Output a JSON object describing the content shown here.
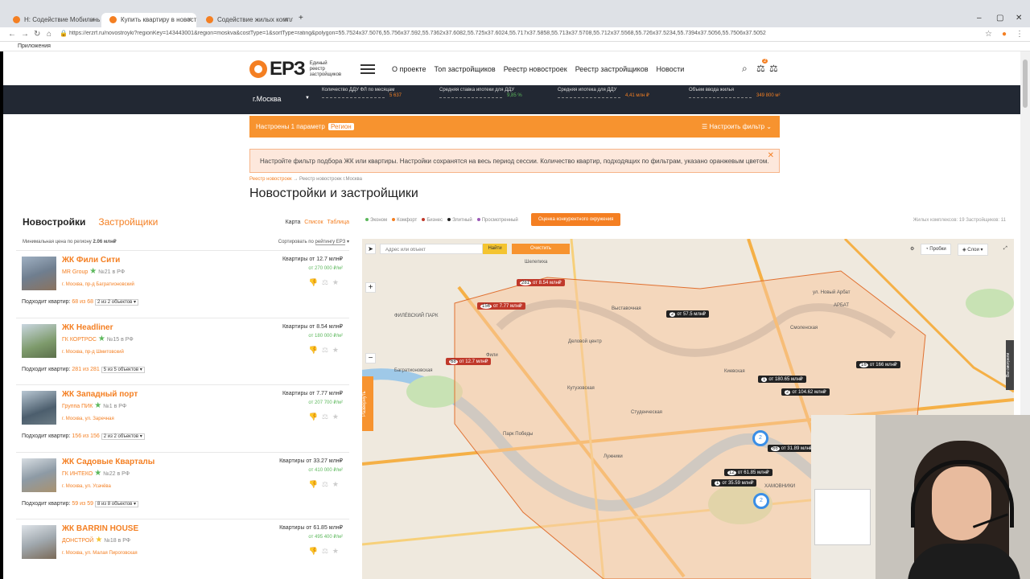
{
  "browser": {
    "tabs": [
      {
        "label": "Н: Содействие Мобильные ПРОБ..."
      },
      {
        "label": "Купить квартиру в новостройке..."
      },
      {
        "label": "Содействие жилых комплексов..."
      }
    ],
    "url": "https://erzrf.ru/novostroyki?regionKey=143443001&region=moskva&costType=1&sortType=rating&polygon=55.7524x37.5076,55.756x37.592,55.7362x37.6082,55.725x37.6024,55.717x37.5858,55.713x37.5708,55.712x37.5568,55.726x37.5234,55.7394x37.5056,55.7506x37.5052",
    "bookmarks_label": "Приложения"
  },
  "header": {
    "logo_text": "ЕРЗ",
    "logo_sub": "Единый реестр застройщиков",
    "nav": [
      "О проекте",
      "Топ застройщиков",
      "Реестр новостроек",
      "Реестр застройщиков",
      "Новости"
    ],
    "notif_count": "2"
  },
  "stats": {
    "city": "г.Москва",
    "items": [
      {
        "label": "Количество ДДУ ФЛ по месяцам",
        "value": "5 637"
      },
      {
        "label": "Средняя ставка ипотеки для ДДУ",
        "value": "9,85 %"
      },
      {
        "label": "Средняя ипотека для ДДУ",
        "value": "4,41 млн ₽"
      },
      {
        "label": "Объем ввода жилья",
        "value": "349 800 м²"
      }
    ]
  },
  "filter": {
    "prefix": "Настроены 1 параметр",
    "chip": "Регион",
    "settings": "Настроить фильтр"
  },
  "notice": "Настройте фильтр подбора ЖК или квартиры. Настройки сохранятся на весь период сессии. Количество квартир, подходящих по фильтрам, указано оранжевым цветом.",
  "breadcrumbs": {
    "a": "Реестр новостроек",
    "sep": "→",
    "b": "Реестр новостроек г.Москва"
  },
  "page_title": "Новостройки и застройщики",
  "left": {
    "tab_active": "Новостройки",
    "tab_other": "Застройщики",
    "view_map": "Карта",
    "view_list": "Список",
    "view_table": "Таблица",
    "min_price_label": "Минимальная цена по региону",
    "min_price": "2.06 млн₽",
    "sort_label": "Сортировать по",
    "sort_value": "рейтингу ЕРЗ",
    "fit_label": "Подходит квартир:",
    "items": [
      {
        "name": "ЖК Фили Сити",
        "developer": "MR Group",
        "rank": "№21 в РФ",
        "address": "г. Москва, пр-д Багратионовский",
        "price": "Квартиры от 12.7 млн₽",
        "ppm": "от 270 000 ₽/м²",
        "fit": "68 из 68",
        "objects": "2 из 2 объектов"
      },
      {
        "name": "ЖК Headliner",
        "developer": "ГК КОРТРОС",
        "rank": "№15 в РФ",
        "address": "г. Москва, пр-д Шмитовский",
        "price": "Квартиры от 8.54 млн₽",
        "ppm": "от 180 000 ₽/м²",
        "fit": "281 из 281",
        "objects": "5 из 5 объектов"
      },
      {
        "name": "ЖК Западный порт",
        "developer": "Группа ПИК",
        "rank": "№1 в РФ",
        "address": "г. Москва, ул. Заречная",
        "price": "Квартиры от 7.77 млн₽",
        "ppm": "от 207 700 ₽/м²",
        "fit": "156 из 156",
        "objects": "2 из 2 объектов"
      },
      {
        "name": "ЖК Садовые Кварталы",
        "developer": "ГК ИНТЕКО",
        "rank": "№22 в РФ",
        "address": "г. Москва, ул. Усачёва",
        "price": "Квартиры от 33.27 млн₽",
        "ppm": "от 410 000 ₽/м²",
        "fit": "59 из 59",
        "objects": "8 из 8 объектов"
      },
      {
        "name": "ЖК BARRIN HOUSE",
        "developer": "ДОНСТРОЙ",
        "rank": "№18 в РФ",
        "address": "г. Москва, ул. Малая Пироговская",
        "price": "Квартиры от 61.85 млн₽",
        "ppm": "от 495 400 ₽/м²",
        "fit": "",
        "objects": ""
      }
    ]
  },
  "map": {
    "legend": [
      {
        "label": "Эконом",
        "color": "#5cb85c"
      },
      {
        "label": "Комфорт",
        "color": "#f47f22"
      },
      {
        "label": "Бизнес",
        "color": "#c0392b"
      },
      {
        "label": "Элитный",
        "color": "#222222"
      },
      {
        "label": "Просмотренный",
        "color": "#9b59b6"
      }
    ],
    "eval_btn": "Оценка конкурентного окружения",
    "counts": "Жилых комплексов: 19   Застройщиков: 11",
    "search_placeholder": "Адрес или объект",
    "find": "Найти",
    "clear": "Очистить",
    "probki": "Пробки",
    "layers": "Слои",
    "expand": "Развернуть",
    "side": "Вы смотрели",
    "markers": [
      {
        "count": "281",
        "price": "от 8.54 млн₽"
      },
      {
        "count": "156",
        "price": "от 7.77 млн₽"
      },
      {
        "count": "68",
        "price": "от 12.7 млн₽"
      },
      {
        "count": "2",
        "price": "от 57.5 млн₽"
      },
      {
        "count": "1",
        "price": "от 180.65 млн₽"
      },
      {
        "count": "2",
        "price": "от 104.62 млн₽"
      },
      {
        "count": "16",
        "price": "от 166 млн₽"
      },
      {
        "count": "66",
        "price": "от 31.89 млн₽"
      },
      {
        "count": "12",
        "price": "от 61.85 млн₽"
      },
      {
        "count": "1",
        "price": "от 35.59 млн₽"
      }
    ],
    "clusters": [
      "2",
      "2"
    ],
    "places": [
      "Шелепиха",
      "ФИЛЁВСКИЙ ПАРК",
      "Багратионовская",
      "Фили",
      "Кутузовская",
      "Деловой центр",
      "Выставочная",
      "Киевская",
      "АРБАТ",
      "Студенческая",
      "Парк Победы",
      "Лужники",
      "Смоленская",
      "ул. Новый Арбат",
      "ХАМОВНИКИ"
    ]
  }
}
